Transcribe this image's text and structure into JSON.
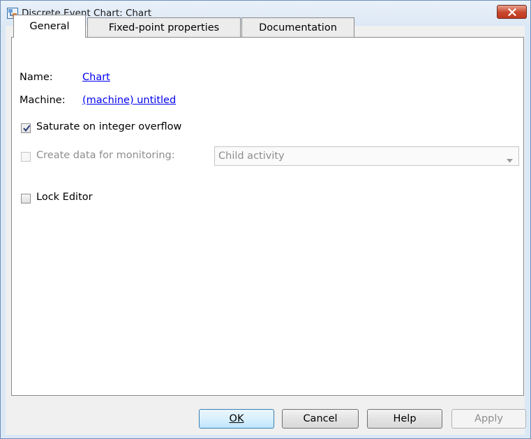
{
  "window": {
    "title": "Discrete Event Chart: Chart"
  },
  "tabs": [
    {
      "label": "General",
      "active": true
    },
    {
      "label": "Fixed-point properties",
      "active": false
    },
    {
      "label": "Documentation",
      "active": false
    }
  ],
  "general": {
    "name_label": "Name:",
    "name_value": "Chart",
    "machine_label": "Machine:",
    "machine_value": "(machine) untitled",
    "saturate_label": "Saturate on integer overflow",
    "saturate_checked": true,
    "monitor_label": "Create data for monitoring:",
    "monitor_checked": false,
    "monitor_enabled": false,
    "monitor_select_value": "Child activity",
    "lock_label": "Lock Editor",
    "lock_checked": false
  },
  "buttons": {
    "ok": "OK",
    "cancel": "Cancel",
    "help": "Help",
    "apply": "Apply"
  },
  "colors": {
    "titlebar": "#dce8f5",
    "close_button": "#c7452c",
    "link": "#0000ee",
    "disabled_text": "#8d8d8d"
  }
}
